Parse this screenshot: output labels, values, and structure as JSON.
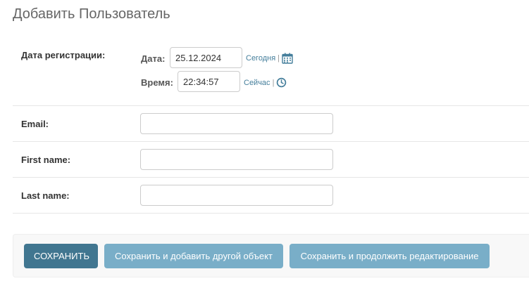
{
  "page": {
    "title": "Добавить Пользователь"
  },
  "form": {
    "date_joined": {
      "label": "Дата регистрации:",
      "date_label": "Дата:",
      "date_value": "25.12.2024",
      "today_link": "Сегодня",
      "separator": "|",
      "calendar_icon": "calendar-icon",
      "time_label": "Время:",
      "time_value": "22:34:57",
      "now_link": "Сейчас",
      "clock_icon": "clock-icon"
    },
    "email": {
      "label": "Email:",
      "value": ""
    },
    "first_name": {
      "label": "First name:",
      "value": ""
    },
    "last_name": {
      "label": "Last name:",
      "value": ""
    }
  },
  "submit_row": {
    "save": "Сохранить",
    "save_add_another": "Сохранить и добавить другой объект",
    "save_continue": "Сохранить и продолжить редактирование"
  },
  "colors": {
    "primary_button": "#417690",
    "secondary_button": "#79aec8",
    "link": "#447e9b"
  }
}
